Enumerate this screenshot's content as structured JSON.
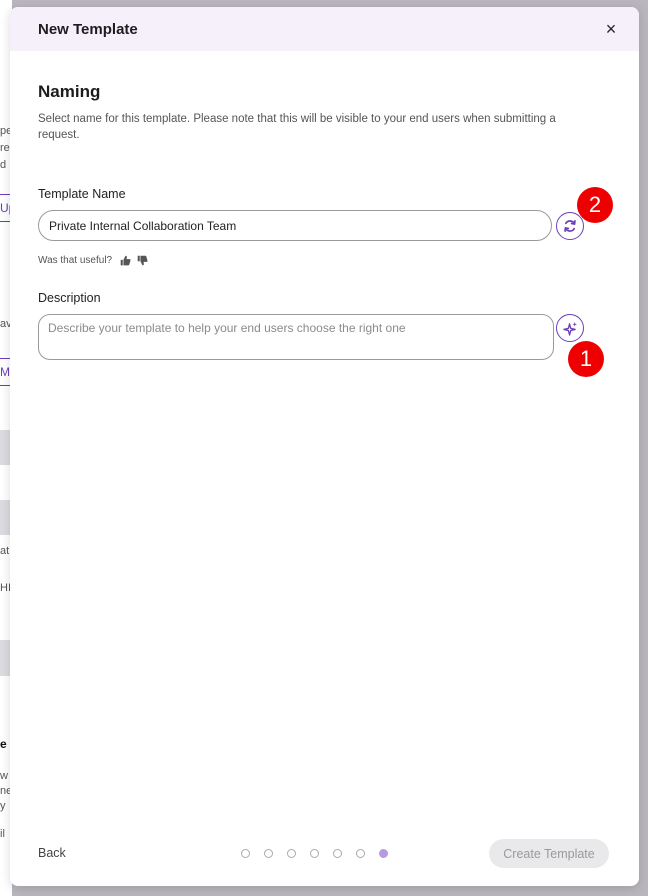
{
  "background": {
    "fragments": [
      "pe",
      "re",
      "d",
      "Up",
      "av",
      "M",
      "at",
      "HI",
      "e",
      "w",
      "ne",
      "y",
      "il"
    ]
  },
  "modal": {
    "title": "New Template",
    "close_symbol": "×"
  },
  "naming": {
    "heading": "Naming",
    "description": "Select name for this template. Please note that this will be visible to your end users when submitting a request."
  },
  "template_name": {
    "label": "Template Name",
    "value": "Private Internal Collaboration Team",
    "regenerate_icon": "refresh-icon"
  },
  "feedback": {
    "question": "Was that useful?",
    "icons": [
      "thumbs-up-icon",
      "thumbs-down-icon"
    ]
  },
  "description_field": {
    "label": "Description",
    "placeholder": "Describe your template to help your end users choose the right one",
    "generate_icon": "sparkles-icon"
  },
  "annotations": {
    "badge_1": "1",
    "badge_2": "2"
  },
  "footer": {
    "back_label": "Back",
    "create_label": "Create Template",
    "steps_total": 7,
    "steps_active_index": 6
  },
  "colors": {
    "accent": "#6b3fb8",
    "header_bg": "#f6f0fb",
    "badge": "#ee0000",
    "active_step": "#b69bdd"
  }
}
